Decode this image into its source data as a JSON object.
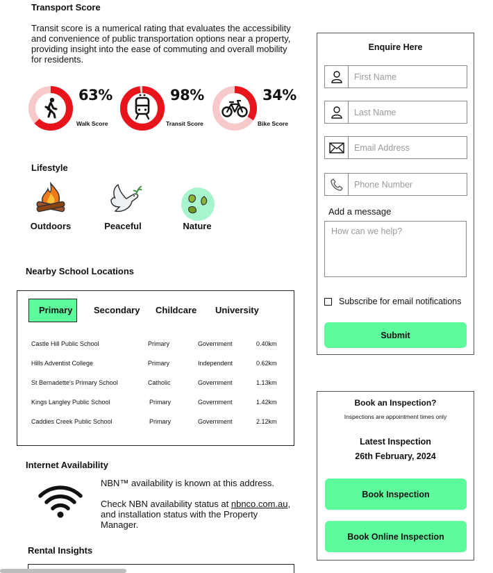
{
  "transport": {
    "title": "Transport Score",
    "desc_lines": [
      "Transit score is a numerical rating that evaluates the accessibility",
      "and convenience of public transportation options near a property,",
      "providing insight into the ease of commuting and overall mobility",
      "for residents."
    ],
    "scores": [
      {
        "pct": "63%",
        "label": "Walk Score",
        "icon": "walking-person-icon",
        "value": 63
      },
      {
        "pct": "98%",
        "label": "Transit Score",
        "icon": "train-icon",
        "value": 98
      },
      {
        "pct": "34%",
        "label": "Bike Score",
        "icon": "bicycle-icon",
        "value": 34
      }
    ],
    "ring_color": "#e8141c",
    "ring_track": "#f8c9c9"
  },
  "lifestyle": {
    "title": "Lifestyle",
    "items": [
      {
        "label": "Outdoors",
        "icon": "campfire-icon"
      },
      {
        "label": "Peaceful",
        "icon": "dove-icon"
      },
      {
        "label": "Nature",
        "icon": "leaves-icon"
      }
    ]
  },
  "schools": {
    "title": "Nearby School Locations",
    "tabs": [
      "Primary",
      "Secondary",
      "Childcare",
      "University"
    ],
    "active_tab": "Primary",
    "rows": [
      [
        "Castle Hill Public School",
        "Primary",
        "Government",
        "0.40km"
      ],
      [
        "Hills Adventist College",
        "Primary",
        "Independent",
        "0.62km"
      ],
      [
        "St Bernadette's Primary School",
        "Catholic",
        "Government",
        "1.13km"
      ],
      [
        "Kings Langley Public School",
        "Primary",
        "Government",
        "1.42km"
      ],
      [
        "Caddies Creek Public School",
        "Primary",
        "Government",
        "2.12km"
      ]
    ]
  },
  "internet": {
    "title": "Internet Availability",
    "line1": "NBN™ availability is known at this address.",
    "line2_prefix": "Check NBN availability status at ",
    "link": "nbnco.com.au",
    "line2_suffix": ",",
    "line3": "and installation status with the Property",
    "line4": "Manager."
  },
  "rental": {
    "title": "Rental Insights"
  },
  "enquire": {
    "title": "Enquire Here",
    "first_name": "First Name",
    "last_name": "Last Name",
    "email": "Email Address",
    "phone": "Phone Number",
    "message_label": "Add a message",
    "message_placeholder": "How can we help?",
    "subscribe": "Subscribe for email notifications",
    "submit": "Submit"
  },
  "inspection": {
    "title": "Book an Inspection?",
    "subtitle": "Inspections are appointment times only",
    "latest_label": "Latest Inspection",
    "latest_date": "26th February, 2024",
    "book": "Book Inspection",
    "book_online": "Book Online Inspection"
  },
  "accent": "#5cfc9c"
}
